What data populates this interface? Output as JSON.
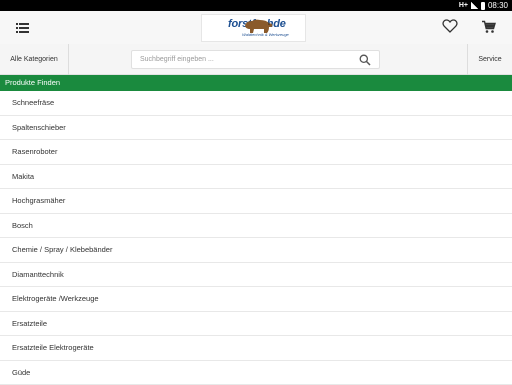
{
  "statusbar": {
    "network": "H+",
    "time": "08:30"
  },
  "header": {
    "logo_text": "forstfachde",
    "logo_tagline": "Waldtechnik & Werkzeuge"
  },
  "toolbar": {
    "categories_label": "Alle Kategorien",
    "search_placeholder": "Suchbegriff eingeben ...",
    "service_label": "Service"
  },
  "section": {
    "title": "Produkte Finden"
  },
  "list": {
    "items": [
      "Schneefräse",
      "Spaltenschieber",
      "Rasenroboter",
      "Makita",
      "Hochgrasmäher",
      "Bosch",
      "Chemie / Spray / Klebebänder",
      "Diamanttechnik",
      "Elektrogeräte /Werkzeuge",
      "Ersatzteile",
      "Ersatzteile Elektrogeräte",
      "Güde"
    ]
  },
  "colors": {
    "accent": "#1a8a3e",
    "logo": "#1d4f91"
  }
}
